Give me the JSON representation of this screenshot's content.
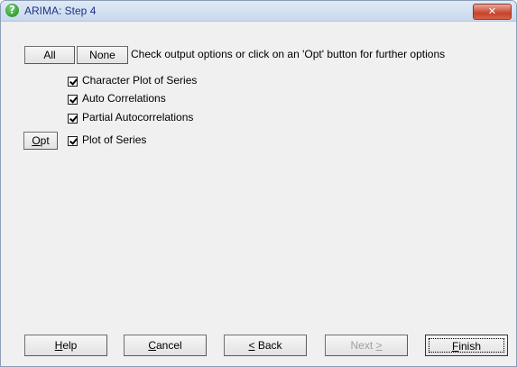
{
  "window": {
    "title": "ARIMA: Step 4",
    "close_glyph": "✕"
  },
  "toolbar": {
    "all_label": "All",
    "none_label": "None",
    "hint": "Check output options or click on an 'Opt' button for further options"
  },
  "options": [
    {
      "label": "Character Plot of Series",
      "checked": true,
      "has_opt": false
    },
    {
      "label": "Auto Correlations",
      "checked": true,
      "has_opt": false
    },
    {
      "label": "Partial Autocorrelations",
      "checked": true,
      "has_opt": false
    },
    {
      "label": "Plot of Series",
      "checked": true,
      "has_opt": true
    }
  ],
  "opt_button": {
    "mnemonic": "O",
    "rest": "pt"
  },
  "footer": {
    "help": {
      "mnemonic": "H",
      "rest": "elp"
    },
    "cancel": {
      "mnemonic": "C",
      "rest": "ancel"
    },
    "back": {
      "prefix": "< ",
      "rest": "Back",
      "mnemonic_char": "<"
    },
    "next": {
      "rest": "Next ",
      "suffix": ">",
      "disabled": true
    },
    "finish": {
      "mnemonic": "F",
      "rest": "inish"
    }
  },
  "icons": {
    "title_icon": "help-question-icon",
    "close_icon": "close-icon"
  }
}
